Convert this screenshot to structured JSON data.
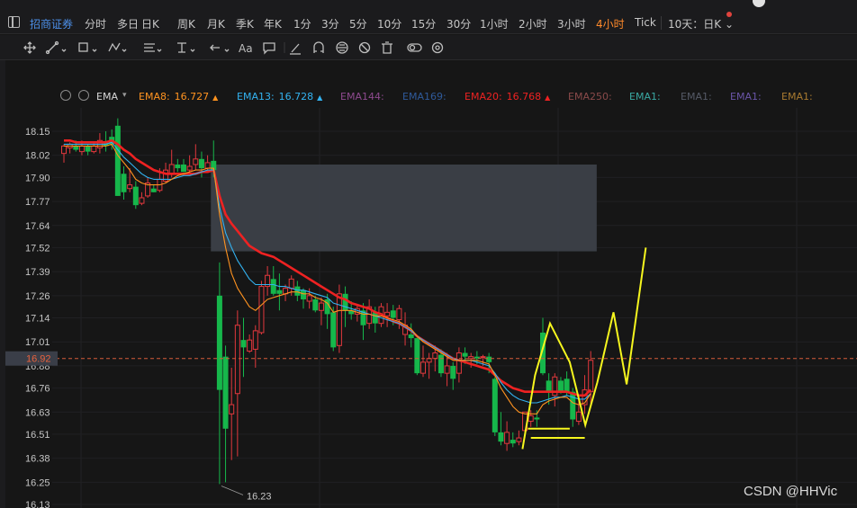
{
  "toolbar": {
    "stock_name": "招商证券",
    "periods": [
      "分时",
      "多日",
      "日K",
      "周K",
      "月K",
      "季K",
      "年K",
      "1分",
      "3分",
      "5分",
      "10分",
      "15分",
      "30分",
      "1小时",
      "2小时",
      "3小时",
      "4小时"
    ],
    "active_period": "4小时",
    "tick_label": "Tick",
    "timeframe_select": "10天：日K"
  },
  "drawing_tools": [
    "move-tool-icon",
    "line-tool-icon",
    "rect-tool-icon",
    "wave-tool-icon",
    "channel-tool-icon",
    "fib-tool-icon",
    "arrow-tool-icon",
    "text-tool-icon",
    "note-tool-icon",
    "pen-tool-icon",
    "magnet-icon",
    "link-icon",
    "eye-off-icon",
    "trash-icon",
    "visibility-icon",
    "settings-icon"
  ],
  "legend": {
    "indicator": "EMA",
    "items": [
      {
        "label": "EMA8:",
        "value": "16.727",
        "color": "#ff9320",
        "arrow": "up"
      },
      {
        "label": "EMA13:",
        "value": "16.728",
        "color": "#33b2f0",
        "arrow": "up"
      },
      {
        "label": "EMA144:",
        "value": "",
        "color": "#8e4a8f"
      },
      {
        "label": "EMA169:",
        "value": "",
        "color": "#2f5a9a"
      },
      {
        "label": "EMA20:",
        "value": "16.768",
        "color": "#ee2222",
        "arrow": "up"
      },
      {
        "label": "EMA250:",
        "value": "",
        "color": "#8a4a4a"
      },
      {
        "label": "EMA1:",
        "value": "",
        "color": "#3aa8a2"
      },
      {
        "label": "EMA1:",
        "value": "",
        "color": "#555a66"
      },
      {
        "label": "EMA1:",
        "value": "",
        "color": "#6a55a8"
      },
      {
        "label": "EMA1:",
        "value": "",
        "color": "#a87a30"
      }
    ]
  },
  "chart_data": {
    "type": "candlestick",
    "ylim": [
      16.13,
      18.15
    ],
    "y_ticks": [
      18.15,
      18.02,
      17.9,
      17.77,
      17.64,
      17.52,
      17.39,
      17.26,
      17.14,
      17.01,
      16.88,
      16.76,
      16.63,
      16.51,
      16.38,
      16.25,
      16.13
    ],
    "current_price": "16.92",
    "low_annotation": "16.23",
    "candles": [
      [
        18.03,
        18.07,
        17.98,
        18.08
      ],
      [
        18.06,
        18.08,
        18.03,
        18.09
      ],
      [
        18.07,
        18.05,
        18.04,
        18.1
      ],
      [
        18.04,
        18.07,
        18.02,
        18.1
      ],
      [
        18.07,
        18.04,
        18.02,
        18.08
      ],
      [
        18.04,
        18.07,
        18.03,
        18.09
      ],
      [
        18.06,
        18.1,
        18.03,
        18.14
      ],
      [
        18.09,
        18.07,
        18.04,
        18.15
      ],
      [
        18.12,
        18.08,
        18.05,
        18.16
      ],
      [
        18.18,
        17.8,
        17.8,
        18.22
      ],
      [
        17.92,
        17.82,
        17.78,
        17.96
      ],
      [
        17.84,
        17.86,
        17.82,
        17.95
      ],
      [
        17.85,
        17.75,
        17.73,
        17.88
      ],
      [
        17.76,
        17.79,
        17.75,
        17.82
      ],
      [
        17.8,
        17.87,
        17.79,
        17.9
      ],
      [
        17.84,
        17.82,
        17.82,
        17.86
      ],
      [
        17.83,
        17.89,
        17.82,
        17.95
      ],
      [
        17.88,
        17.94,
        17.87,
        17.98
      ],
      [
        17.92,
        17.97,
        17.9,
        18.05
      ],
      [
        17.97,
        17.95,
        17.93,
        18.0
      ],
      [
        17.97,
        17.93,
        17.93,
        18.0
      ],
      [
        17.94,
        17.96,
        17.92,
        18.02
      ],
      [
        17.97,
        18.0,
        17.94,
        18.08
      ],
      [
        18.0,
        17.95,
        17.9,
        18.04
      ],
      [
        17.95,
        17.98,
        17.93,
        18.02
      ],
      [
        17.99,
        17.94,
        17.9,
        18.1
      ],
      [
        17.26,
        16.75,
        16.24,
        17.44
      ],
      [
        16.93,
        16.54,
        16.25,
        16.99
      ],
      [
        16.62,
        16.67,
        16.37,
        16.87
      ],
      [
        16.73,
        17.1,
        16.39,
        17.18
      ],
      [
        17.02,
        16.98,
        16.82,
        17.14
      ],
      [
        16.96,
        17.02,
        16.95,
        17.05
      ],
      [
        16.97,
        17.07,
        16.87,
        17.1
      ],
      [
        17.06,
        17.31,
        17.05,
        17.34
      ],
      [
        17.31,
        17.37,
        17.26,
        17.42
      ],
      [
        17.35,
        17.27,
        17.26,
        17.42
      ],
      [
        17.29,
        17.27,
        17.18,
        17.38
      ],
      [
        17.27,
        17.3,
        17.23,
        17.32
      ],
      [
        17.3,
        17.35,
        17.26,
        17.37
      ],
      [
        17.31,
        17.26,
        17.23,
        17.34
      ],
      [
        17.29,
        17.24,
        17.19,
        17.3
      ],
      [
        17.23,
        17.26,
        17.19,
        17.3
      ],
      [
        17.24,
        17.18,
        17.17,
        17.26
      ],
      [
        17.18,
        17.22,
        17.1,
        17.25
      ],
      [
        17.24,
        17.16,
        17.08,
        17.27
      ],
      [
        17.17,
        16.98,
        16.96,
        17.2
      ],
      [
        16.99,
        17.27,
        16.95,
        17.32
      ],
      [
        17.27,
        17.18,
        17.09,
        17.31
      ],
      [
        17.18,
        17.16,
        17.13,
        17.23
      ],
      [
        17.16,
        17.19,
        17.12,
        17.21
      ],
      [
        17.18,
        17.1,
        17.02,
        17.22
      ],
      [
        17.11,
        17.2,
        17.08,
        17.24
      ],
      [
        17.17,
        17.11,
        17.06,
        17.2
      ],
      [
        17.11,
        17.2,
        17.09,
        17.22
      ],
      [
        17.15,
        17.17,
        17.09,
        17.22
      ],
      [
        17.18,
        17.14,
        17.1,
        17.21
      ],
      [
        17.13,
        17.19,
        17.08,
        17.21
      ],
      [
        17.05,
        17.1,
        16.99,
        17.17
      ],
      [
        17.05,
        17.03,
        16.98,
        17.11
      ],
      [
        17.03,
        16.84,
        16.83,
        17.04
      ],
      [
        16.84,
        16.9,
        16.82,
        16.99
      ],
      [
        16.9,
        16.92,
        16.81,
        16.95
      ],
      [
        16.92,
        16.95,
        16.85,
        16.99
      ],
      [
        16.94,
        16.84,
        16.82,
        16.97
      ],
      [
        16.84,
        16.88,
        16.77,
        16.95
      ],
      [
        16.88,
        16.81,
        16.75,
        16.9
      ],
      [
        16.84,
        16.95,
        16.79,
        16.98
      ],
      [
        16.95,
        16.93,
        16.89,
        16.98
      ],
      [
        16.92,
        16.93,
        16.87,
        16.95
      ],
      [
        16.93,
        16.92,
        16.89,
        16.96
      ],
      [
        16.93,
        16.93,
        16.88,
        16.94
      ],
      [
        16.93,
        16.9,
        16.84,
        16.95
      ],
      [
        16.81,
        16.52,
        16.5,
        16.82
      ],
      [
        16.52,
        16.47,
        16.45,
        16.63
      ],
      [
        16.46,
        16.52,
        16.42,
        16.58
      ],
      [
        16.48,
        16.46,
        16.44,
        16.52
      ],
      [
        16.47,
        16.49,
        16.45,
        16.53
      ],
      [
        16.53,
        16.63,
        16.49,
        16.63
      ],
      [
        16.58,
        16.61,
        16.55,
        16.64
      ],
      [
        16.6,
        16.59,
        16.55,
        16.64
      ],
      [
        17.06,
        16.84,
        16.83,
        17.14
      ],
      [
        16.8,
        16.74,
        16.67,
        16.84
      ],
      [
        16.72,
        16.82,
        16.66,
        16.84
      ],
      [
        16.8,
        16.74,
        16.73,
        16.82
      ],
      [
        16.81,
        16.74,
        16.72,
        16.85
      ],
      [
        16.74,
        16.59,
        16.55,
        16.76
      ],
      [
        16.58,
        16.63,
        16.56,
        16.71
      ],
      [
        16.67,
        16.75,
        16.62,
        16.83
      ],
      [
        16.74,
        16.91,
        16.67,
        16.96
      ]
    ],
    "series": [
      {
        "name": "EMA20",
        "color": "#ee2222",
        "values": [
          18.1,
          18.1,
          18.09,
          18.09,
          18.09,
          18.09,
          18.09,
          18.09,
          18.1,
          18.08,
          18.05,
          18.03,
          18.0,
          17.98,
          17.96,
          17.94,
          17.93,
          17.92,
          17.92,
          17.92,
          17.92,
          17.92,
          17.92,
          17.93,
          17.93,
          17.94,
          17.8,
          17.7,
          17.65,
          17.61,
          17.57,
          17.53,
          17.51,
          17.49,
          17.48,
          17.47,
          17.45,
          17.43,
          17.41,
          17.39,
          17.37,
          17.35,
          17.33,
          17.31,
          17.29,
          17.27,
          17.25,
          17.24,
          17.22,
          17.21,
          17.2,
          17.19,
          17.17,
          17.16,
          17.14,
          17.12,
          17.11,
          17.09,
          17.07,
          17.04,
          17.02,
          17.0,
          16.98,
          16.96,
          16.94,
          16.92,
          16.91,
          16.9,
          16.89,
          16.88,
          16.87,
          16.86,
          16.83,
          16.8,
          16.78,
          16.76,
          16.75,
          16.74,
          16.74,
          16.74,
          16.74,
          16.74,
          16.74,
          16.74,
          16.74,
          16.73,
          16.72,
          16.72,
          16.75
        ]
      },
      {
        "name": "EMA13",
        "color": "#33b2f0",
        "values": [
          18.08,
          18.08,
          18.08,
          18.08,
          18.08,
          18.08,
          18.08,
          18.08,
          18.09,
          18.05,
          18.01,
          17.98,
          17.95,
          17.92,
          17.9,
          17.89,
          17.89,
          17.89,
          17.89,
          17.9,
          17.91,
          17.91,
          17.92,
          17.93,
          17.94,
          17.94,
          17.74,
          17.6,
          17.52,
          17.45,
          17.4,
          17.35,
          17.32,
          17.32,
          17.32,
          17.32,
          17.31,
          17.31,
          17.3,
          17.29,
          17.29,
          17.28,
          17.27,
          17.26,
          17.25,
          17.22,
          17.21,
          17.2,
          17.19,
          17.18,
          17.17,
          17.16,
          17.15,
          17.14,
          17.13,
          17.12,
          17.11,
          17.09,
          17.07,
          17.04,
          17.02,
          17.0,
          16.98,
          16.96,
          16.94,
          16.92,
          16.91,
          16.91,
          16.91,
          16.9,
          16.89,
          16.88,
          16.84,
          16.79,
          16.75,
          16.72,
          16.7,
          16.69,
          16.68,
          16.68,
          16.69,
          16.7,
          16.71,
          16.71,
          16.72,
          16.71,
          16.7,
          16.7,
          16.73
        ]
      },
      {
        "name": "EMA8",
        "color": "#ff9320",
        "values": [
          18.07,
          18.07,
          18.07,
          18.07,
          18.07,
          18.07,
          18.07,
          18.07,
          18.08,
          18.02,
          17.98,
          17.94,
          17.89,
          17.87,
          17.86,
          17.86,
          17.86,
          17.87,
          17.89,
          17.91,
          17.92,
          17.93,
          17.94,
          17.94,
          17.95,
          17.95,
          17.7,
          17.52,
          17.38,
          17.3,
          17.25,
          17.2,
          17.18,
          17.21,
          17.24,
          17.25,
          17.26,
          17.27,
          17.28,
          17.28,
          17.27,
          17.27,
          17.25,
          17.24,
          17.22,
          17.17,
          17.18,
          17.18,
          17.18,
          17.17,
          17.16,
          17.16,
          17.15,
          17.15,
          17.14,
          17.13,
          17.12,
          17.1,
          17.08,
          17.04,
          17.01,
          16.99,
          16.97,
          16.95,
          16.93,
          16.91,
          16.91,
          16.91,
          16.91,
          16.91,
          16.9,
          16.89,
          16.83,
          16.76,
          16.71,
          16.66,
          16.63,
          16.62,
          16.62,
          16.62,
          16.67,
          16.69,
          16.7,
          16.71,
          16.71,
          16.68,
          16.67,
          16.68,
          16.73
        ]
      }
    ],
    "zone": {
      "from_candle": 25,
      "to_candle": 89,
      "price_low": 17.5,
      "price_high": 17.97,
      "color": "#3c4048"
    },
    "annotation_lines": [
      {
        "color": "#f6f61e",
        "points": [
          [
            76.6,
            16.43
          ],
          [
            78.7,
            16.83
          ],
          [
            81.2,
            17.11
          ],
          [
            84.5,
            16.9
          ],
          [
            87.1,
            16.56
          ],
          [
            89.1,
            16.79
          ],
          [
            91.8,
            17.17
          ],
          [
            94.0,
            16.78
          ],
          [
            97.2,
            17.52
          ]
        ]
      },
      {
        "color": "#f6f61e",
        "points": [
          [
            77.5,
            16.54
          ],
          [
            84.5,
            16.54
          ]
        ]
      },
      {
        "color": "#f6f61e",
        "points": [
          [
            78.0,
            16.49
          ],
          [
            87.0,
            16.49
          ]
        ]
      }
    ]
  },
  "watermark": "CSDN @HHVic"
}
